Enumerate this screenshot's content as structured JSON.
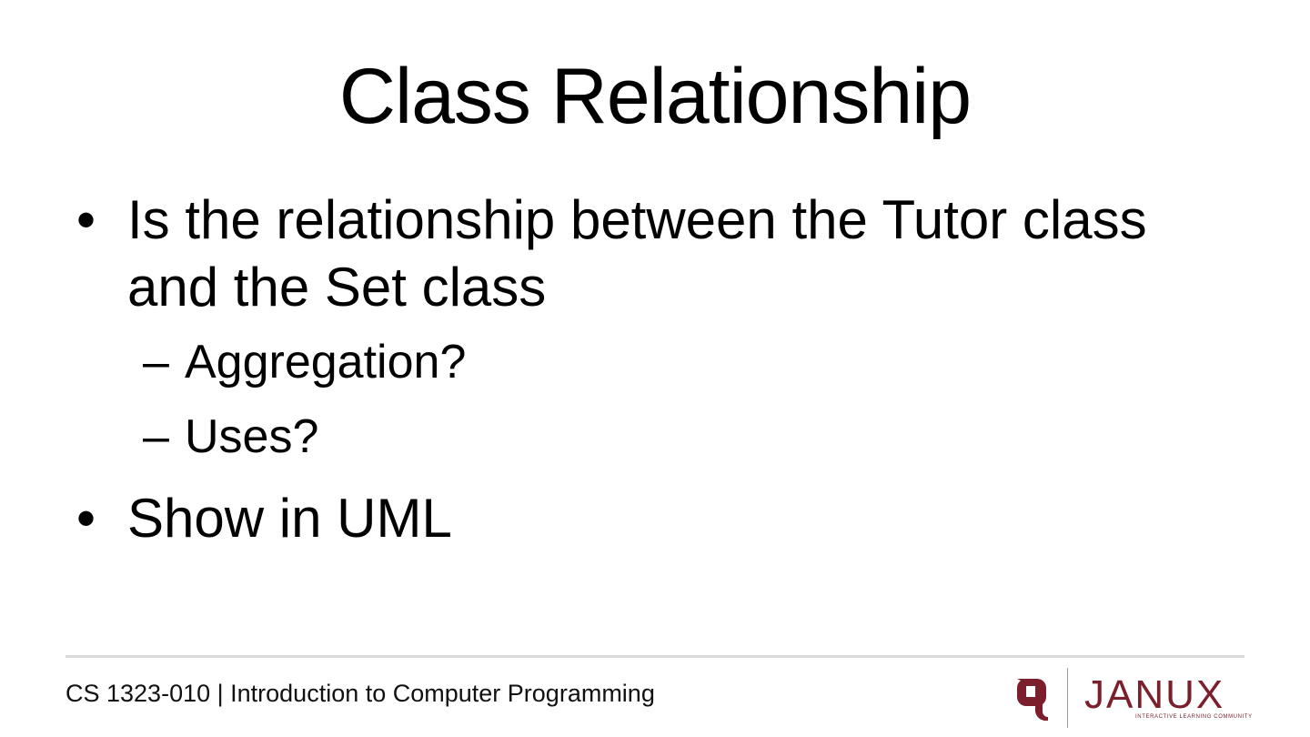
{
  "slide": {
    "title": "Class Relationship",
    "bullets": [
      {
        "marker": "•",
        "text": "Is the relationship between the Tutor class and the Set class",
        "sub_items": [
          {
            "marker": "–",
            "text": "Aggregation?"
          },
          {
            "marker": "–",
            "text": "Uses?"
          }
        ]
      },
      {
        "marker": "•",
        "text": "Show in UML"
      }
    ]
  },
  "footer": {
    "course": "CS 1323-010 | Introduction to Computer Programming",
    "logo_ou_icon": "ou-monogram-icon",
    "logo_brand": "JANUX",
    "logo_tagline": "INTERACTIVE LEARNING COMMUNITY",
    "brand_color": "#7b1f2d",
    "rule_color": "#d9d9d9"
  }
}
